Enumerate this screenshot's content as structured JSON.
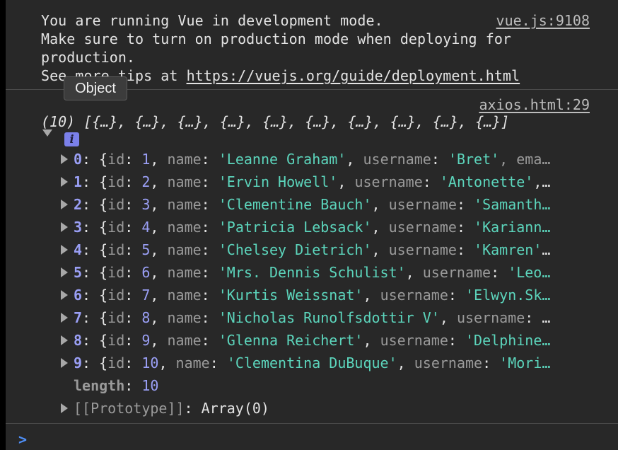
{
  "warning": {
    "lines": [
      "You are running Vue in development mode.",
      "Make sure to turn on production mode when deploying for",
      "production.",
      "See more tips at "
    ],
    "url": "https://vuejs.org/guide/deployment.html",
    "source": "vue.js:9108"
  },
  "tooltip": {
    "text": "Object"
  },
  "log": {
    "source": "axios.html:29",
    "summary": "(10) [{…}, {…}, {…}, {…}, {…}, {…}, {…}, {…}, {…}, {…}]",
    "info_badge": "i",
    "items": [
      {
        "index": "0",
        "id": "1",
        "name": "'Leanne Graham'",
        "username": "'Bret'",
        "tail": ", ema…"
      },
      {
        "index": "1",
        "id": "2",
        "name": "'Ervin Howell'",
        "username": "'Antonette'",
        "tail": ",…"
      },
      {
        "index": "2",
        "id": "3",
        "name": "'Clementine Bauch'",
        "username": "'Samanth…",
        "tail": ""
      },
      {
        "index": "3",
        "id": "4",
        "name": "'Patricia Lebsack'",
        "username": "'Kariann…",
        "tail": ""
      },
      {
        "index": "4",
        "id": "5",
        "name": "'Chelsey Dietrich'",
        "username": "'Kamren'",
        "tail": "…"
      },
      {
        "index": "5",
        "id": "6",
        "name": "'Mrs. Dennis Schulist'",
        "username": "'Leo…",
        "tail": ""
      },
      {
        "index": "6",
        "id": "7",
        "name": "'Kurtis Weissnat'",
        "username": "'Elwyn.Sk…",
        "tail": ""
      },
      {
        "index": "7",
        "id": "8",
        "name": "'Nicholas Runolfsdottir V'",
        "username": "…",
        "tail": ""
      },
      {
        "index": "8",
        "id": "9",
        "name": "'Glenna Reichert'",
        "username": "'Delphine…",
        "tail": ""
      },
      {
        "index": "9",
        "id": "10",
        "name": "'Clementina DuBuque'",
        "username": "'Mori…",
        "tail": ""
      }
    ],
    "length_label": "length",
    "length_value": "10",
    "prototype_label": "[[Prototype]]",
    "prototype_value": "Array(0)"
  },
  "prompt": {
    "symbol": ">"
  },
  "colors": {
    "background": "#282828",
    "index": "#9a9ff5",
    "string": "#5cd5bc",
    "key": "#9a9a9a",
    "prompt": "#4f8ff7"
  }
}
